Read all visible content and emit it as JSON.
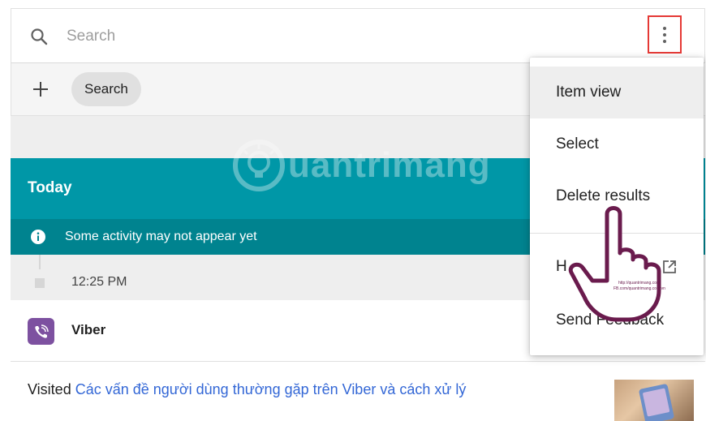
{
  "search": {
    "placeholder": "Search"
  },
  "filter": {
    "chip_label": "Search"
  },
  "watermark": {
    "text": "uantrimang"
  },
  "activity": {
    "section_title": "Today",
    "notice": "Some activity may not appear yet",
    "time": "12:25 PM",
    "app_name": "Viber",
    "visited_prefix": "Visited",
    "visited_link": "Các vấn đề người dùng thường gặp trên Viber và cách xử lý"
  },
  "menu": {
    "items": [
      {
        "label": "Item view"
      },
      {
        "label": "Select"
      },
      {
        "label": "Delete results"
      },
      {
        "label": "H"
      },
      {
        "label": "Send Feedback"
      }
    ]
  },
  "hand_overlay": {
    "caption_line1": "http://quantrimang.com/",
    "caption_line2": "FB.com/quantrimang.com.vn"
  },
  "colors": {
    "accent_teal": "#0097a7",
    "notice_teal": "#00838f",
    "link_blue": "#3367d6",
    "viber_purple": "#7d51a0",
    "highlight_red": "#e53935"
  },
  "icons": {
    "search": "search-icon",
    "more": "more-vert-icon",
    "add": "add-icon",
    "info": "info-icon",
    "app": "viber-icon",
    "external": "open-in-new-icon"
  }
}
